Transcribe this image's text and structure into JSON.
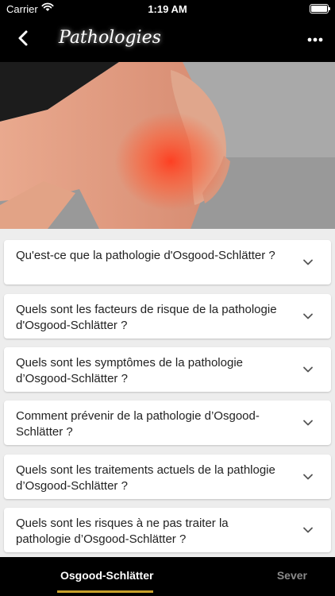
{
  "status": {
    "carrier": "Carrier",
    "time": "1:19 AM"
  },
  "header": {
    "title": "Pathologies"
  },
  "faq": [
    {
      "question": "Qu'est-ce que la pathologie d'Osgood-Schlätter ?"
    },
    {
      "question": "Quels sont les facteurs de risque de la pathologie d'Osgood-Schlätter ?"
    },
    {
      "question": "Quels sont les symptômes de la pathologie d’Osgood-Schlätter ?"
    },
    {
      "question": "Comment prévenir de la pathologie d’Osgood-Schlätter ?"
    },
    {
      "question": "Quels sont les traitements actuels  de la pathlogie d’Osgood-Schlätter ?"
    },
    {
      "question": "Quels sont les risques à ne pas traiter la pathologie d’Osgood-Schlätter ?"
    }
  ],
  "tabs": [
    {
      "label": "Osgood-Schlätter",
      "active": true
    },
    {
      "label": "Sever",
      "active": false
    }
  ],
  "colors": {
    "accent": "#c8a02b",
    "bar": "#000000",
    "background": "#ededed"
  }
}
